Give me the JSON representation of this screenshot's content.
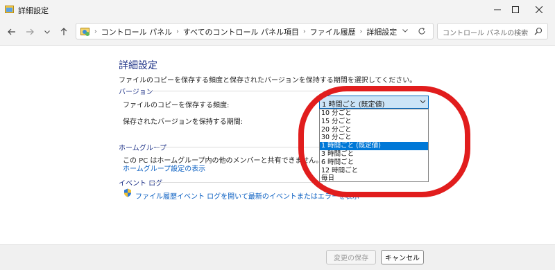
{
  "window": {
    "title": "詳細設定"
  },
  "nav": {
    "breadcrumbs": [
      "コントロール パネル",
      "すべてのコントロール パネル項目",
      "ファイル履歴",
      "詳細設定"
    ],
    "search_placeholder": "コントロール パネルの検索"
  },
  "main": {
    "title": "詳細設定",
    "description": "ファイルのコピーを保存する頻度と保存されたバージョンを保持する期間を選択してください。",
    "versions": {
      "heading": "バージョン",
      "frequency_label": "ファイルのコピーを保存する頻度:",
      "retention_label": "保存されたバージョンを保持する期間:",
      "frequency_selected": "1 時間ごと (既定値)",
      "frequency_options": [
        "10 分ごと",
        "15 分ごと",
        "20 分ごと",
        "30 分ごと",
        "1 時間ごと (既定値)",
        "3 時間ごと",
        "6 時間ごと",
        "12 時間ごと",
        "毎日"
      ],
      "highlighted_index": 4
    },
    "homegroup": {
      "heading": "ホームグループ",
      "text": "この PC はホームグループ内の他のメンバーと共有できません。",
      "link": "ホームグループ設定の表示"
    },
    "eventlog": {
      "heading": "イベント ログ",
      "link": "ファイル履歴イベント ログを開いて最新のイベントまたはエラーを表示"
    }
  },
  "footer": {
    "save_label": "変更の保存",
    "cancel_label": "キャンセル"
  },
  "colors": {
    "accent": "#0078d7",
    "heading": "#1e3287",
    "link": "#0a5fc2",
    "annotation": "#e11d1d"
  }
}
